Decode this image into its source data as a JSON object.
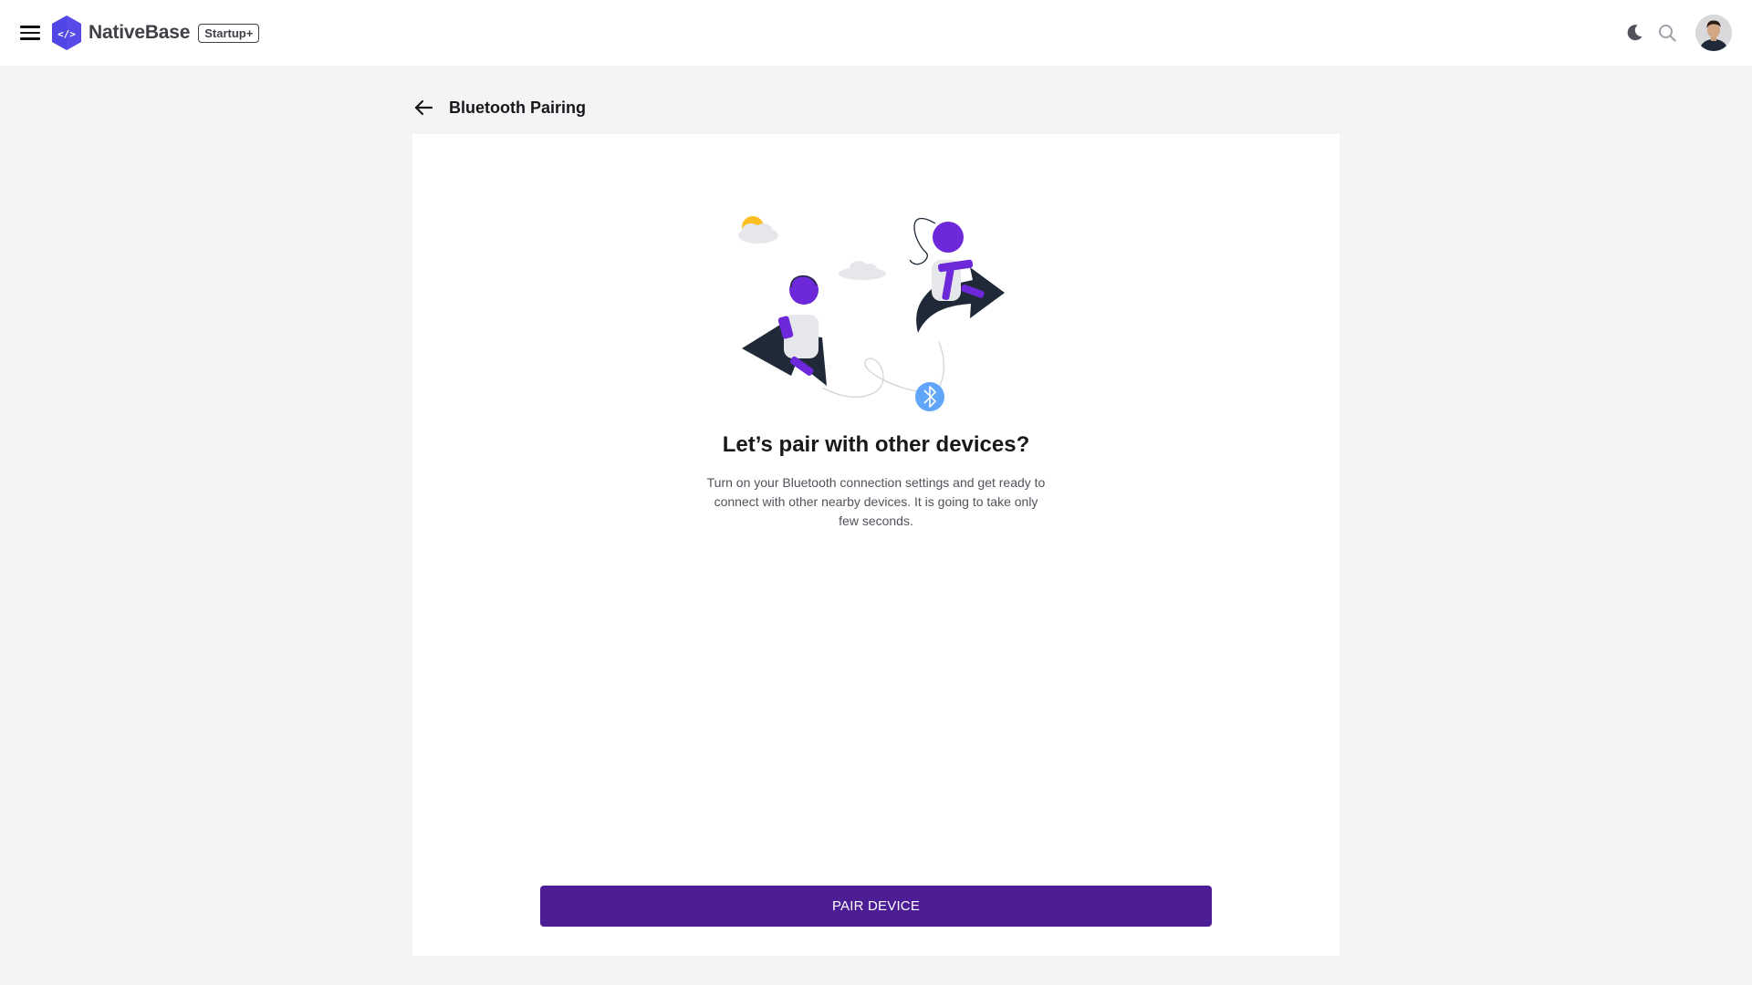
{
  "header": {
    "brand_name": "NativeBase",
    "brand_badge": "Startup+",
    "icons": [
      "menu-icon",
      "nativebase-logo-icon",
      "moon-icon",
      "search-icon"
    ]
  },
  "page": {
    "title": "Bluetooth Pairing",
    "back_icon": "arrow-left-icon"
  },
  "content": {
    "heading": "Let’s pair with other devices?",
    "description": "Turn on your Bluetooth connection settings and get ready to connect with other nearby devices. It is going to take only few seconds.",
    "button_label": "PAIR DEVICE"
  },
  "colors": {
    "primary": "#4c1d95",
    "accent_purple": "#6d28d9",
    "background": "#f3f4f6",
    "card": "#ffffff",
    "bluetooth_blue": "#60a5fa"
  }
}
